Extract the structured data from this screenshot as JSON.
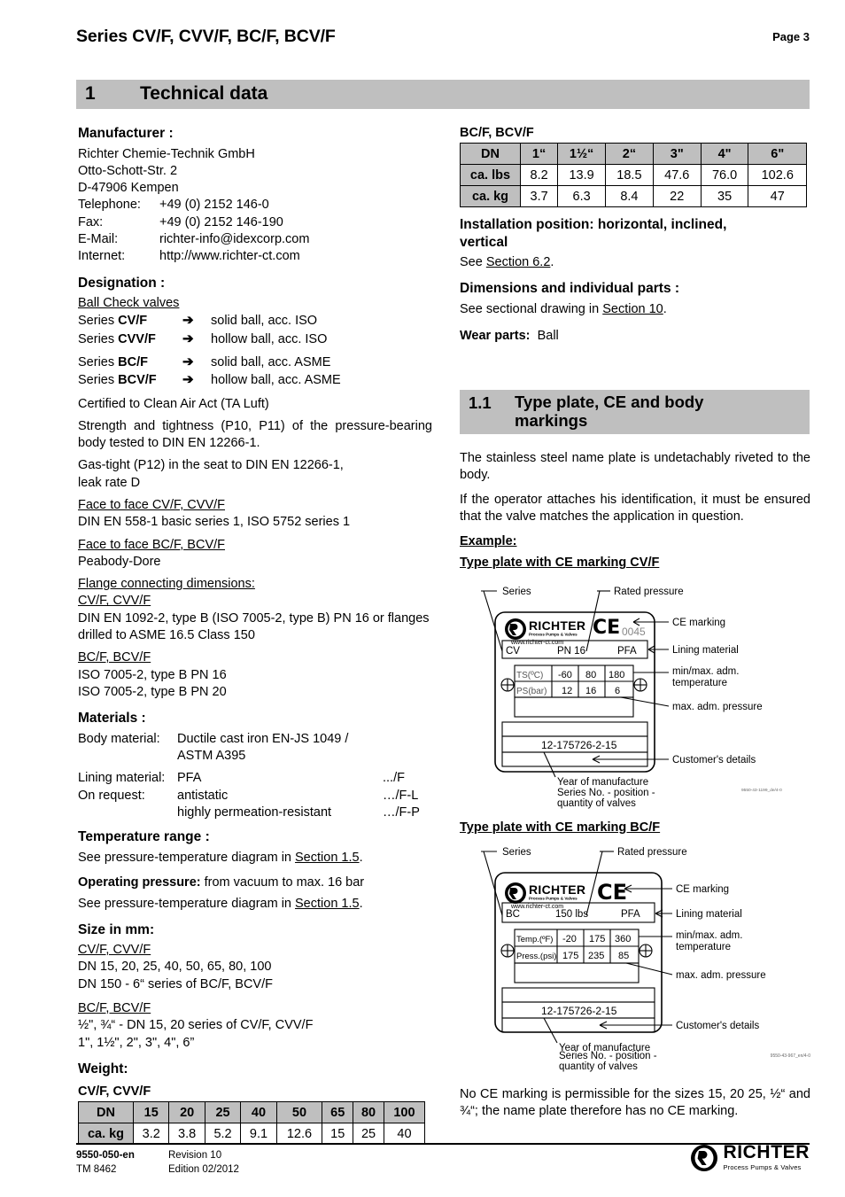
{
  "header": {
    "title": "Series CV/F, CVV/F, BC/F, BCV/F",
    "page_label": "Page 3"
  },
  "section1": {
    "number": "1",
    "title": "Technical data"
  },
  "manufacturer": {
    "heading": "Manufacturer :",
    "company": "Richter Chemie-Technik GmbH",
    "street": "Otto-Schott-Str. 2",
    "city": "D-47906 Kempen",
    "telephone_label": "Telephone:",
    "telephone": "+49 (0) 2152 146-0",
    "fax_label": "Fax:",
    "fax": "+49 (0) 2152 146-190",
    "email_label": "E-Mail:",
    "email": "richter-info@idexcorp.com",
    "internet_label": "Internet:",
    "internet": "http://www.richter-ct.com"
  },
  "designation": {
    "heading": "Designation :",
    "subtitle": "Ball Check valves",
    "rows": [
      {
        "series": "Series CV/F",
        "series_plain": "Series ",
        "series_bold": "CV/F",
        "arrow": "➔",
        "desc": "solid ball, acc. ISO"
      },
      {
        "series_plain": "Series ",
        "series_bold": "CVV/F",
        "arrow": "➔",
        "desc": "hollow ball, acc. ISO"
      },
      {
        "series_plain": "Series ",
        "series_bold": "BC/F",
        "arrow": "➔",
        "desc": "solid ball, acc. ASME"
      },
      {
        "series_plain": "Series ",
        "series_bold": "BCV/F",
        "arrow": "➔",
        "desc": "hollow ball, acc. ASME"
      }
    ],
    "certified": "Certified to Clean Air Act (TA Luft)",
    "strength": "Strength and tightness (P10, P11) of the pressure-bearing body tested to DIN EN 12266-1.",
    "gastight_1": "Gas-tight (P12) in the seat  to DIN EN 12266-1,",
    "gastight_2": "leak rate D",
    "f2f_cv_head": "Face to face CV/F, CVV/F",
    "f2f_cv_val": "DIN EN 558-1 basic series 1, ISO 5752 series 1",
    "f2f_bc_head": "Face to face BC/F, BCV/F",
    "f2f_bc_val": "Peabody-Dore",
    "flange_head": "Flange connecting dimensions:",
    "flange_cv_head": "CV/F, CVV/F",
    "flange_cv_val": "DIN EN 1092-2, type B  (ISO 7005-2, type B) PN 16 or flanges drilled to ASME 16.5 Class 150",
    "flange_bc_head": "BC/F, BCV/F",
    "flange_bc_val1": "ISO 7005-2, type B PN 16",
    "flange_bc_val2": "ISO 7005-2, type B PN 20"
  },
  "materials": {
    "heading": "Materials :",
    "body_label": "Body material:",
    "body_val1": "Ductile cast iron EN-JS 1049 /",
    "body_val2": "ASTM A395",
    "lining_label": "Lining material:",
    "lining_val": "PFA",
    "lining_code": ".../F",
    "request_label": "On request:",
    "request_val1": "antistatic",
    "request_code1": "…/F-L",
    "request_val2": "highly permeation-resistant",
    "request_code2": "…/F-P"
  },
  "temperature": {
    "heading": "Temperature range :",
    "text_pre": "See pressure-temperature diagram in ",
    "text_link": "Section 1.5",
    "text_post": "."
  },
  "operating": {
    "heading": "Operating pressure:",
    "heading_rest": " from vacuum to max. 16 bar",
    "text_pre": "See pressure-temperature diagram in ",
    "text_link": "Section 1.5",
    "text_post": "."
  },
  "size": {
    "heading": "Size in mm:",
    "cv_head": "CV/F, CVV/F",
    "cv_line1": "DN 15, 20, 25, 40, 50, 65, 80, 100",
    "cv_line2": "DN 150 - 6“ series of BC/F, BCV/F",
    "bc_head": "BC/F, BCV/F",
    "bc_line1": "½\", ¾“ - DN 15, 20 series of CV/F, CVV/F",
    "bc_line2": "1\", 1½\", 2\", 3\", 4\", 6”"
  },
  "weight": {
    "heading": "Weight:",
    "cv_subhead": "CV/F, CVV/F"
  },
  "chart_data": [
    {
      "type": "table",
      "title": "CV/F, CVV/F",
      "row_headers": [
        "DN",
        "ca. kg"
      ],
      "categories": [
        "15",
        "20",
        "25",
        "40",
        "50",
        "65",
        "80",
        "100"
      ],
      "values": [
        "3.2",
        "3.8",
        "5.2",
        "9.1",
        "12.6",
        "15",
        "25",
        "40"
      ]
    },
    {
      "type": "table",
      "title": "BC/F, BCV/F",
      "row_headers": [
        "DN",
        "ca. lbs",
        "ca. kg"
      ],
      "categories": [
        "1“",
        "1½“",
        "2“",
        "3\"",
        "4\"",
        "6\""
      ],
      "series": [
        {
          "name": "ca. lbs",
          "values": [
            "8.2",
            "13.9",
            "18.5",
            "47.6",
            "76.0",
            "102.6"
          ]
        },
        {
          "name": "ca. kg",
          "values": [
            "3.7",
            "6.3",
            "8.4",
            "22",
            "35",
            "47"
          ]
        }
      ]
    }
  ],
  "right": {
    "bc_table_head": "BC/F, BCV/F",
    "install_heading_1": "Installation position: horizontal, inclined,",
    "install_heading_2": "vertical",
    "install_see_pre": "See ",
    "install_see_link": "Section 6.2",
    "install_see_post": ".",
    "dims_heading": "Dimensions and individual parts :",
    "dims_pre": "See sectional drawing in ",
    "dims_link": "Section 10",
    "dims_post": ".",
    "wear_heading": "Wear parts:",
    "wear_value": "Ball"
  },
  "section11": {
    "number": "1.1",
    "title_line1": "Type plate, CE and body",
    "title_line2": "markings",
    "para1": "The stainless steel name plate is undetachably riveted to the body.",
    "para2": "If the operator attaches his identification, it must be ensured that the valve matches the application in question.",
    "example_label": "Example:",
    "plate_cv_caption": "Type plate with CE marking CV/F",
    "plate_bc_caption": "Type plate with CE marking BC/F",
    "closing_note": "No CE marking is permissible for the sizes 15, 20 25, ½“ and ¾“; the name plate therefore has no CE marking."
  },
  "plate_cv": {
    "callout_series": "Series",
    "callout_rated": "Rated pressure",
    "callout_ce": "CE marking",
    "callout_lining": "Lining material",
    "callout_temp_1": "min/max. adm.",
    "callout_temp_2": "temperature",
    "callout_press": "max. adm. pressure",
    "callout_customer": "Customer's details",
    "callout_year_1": "Year of manufacture",
    "callout_year_2": "Series No. - position -",
    "callout_year_3": "quantity of valves",
    "brand": "RICHTER",
    "brand_sub": "Process Pumps & Valves",
    "url": "www.richter-ct.com",
    "ce_text": "CE",
    "ce_number": "0045",
    "series_code": "CV",
    "rated_pressure": "PN 16",
    "lining": "PFA",
    "temp_row_label": "TS(ºC)",
    "press_row_label": "PS(bar)",
    "temp_values": [
      "-60",
      "80",
      "180"
    ],
    "press_values": [
      "12",
      "16",
      "6"
    ],
    "serial": "12-175726-2-15",
    "drawing_ref": "9550-43-1199_de/4-0"
  },
  "plate_bc": {
    "callout_series": "Series",
    "callout_rated": "Rated pressure",
    "callout_ce": "CE marking",
    "callout_lining": "Lining material",
    "callout_temp_1": "min/max. adm.",
    "callout_temp_2": "temperature",
    "callout_press": "max. adm. pressure",
    "callout_customer": "Customer's details",
    "callout_year_1": "Year of manufacture",
    "callout_year_2": "Series No. - position -",
    "callout_year_3": "quantity of valves",
    "brand": "RICHTER",
    "brand_sub": "Process Pumps & Valves",
    "url": "www.richter-ct.com",
    "ce_text": "CE",
    "series_code": "BC",
    "rated_pressure": "150 lbs",
    "lining": "PFA",
    "temp_row_label": "Temp.(ºF)",
    "press_row_label": "Press.(psi)",
    "temp_values": [
      "-20",
      "175",
      "360"
    ],
    "press_values": [
      "175",
      "235",
      "85"
    ],
    "serial": "12-175726-2-15",
    "drawing_ref": "9550-43-967_en/4-0"
  },
  "footer": {
    "doc_no": "9550-050-en",
    "tm_no": "TM 8462",
    "revision": "Revision  10",
    "edition": "Edition  02/2012",
    "logo_text": "RICHTER",
    "logo_sub": "Process Pumps & Valves"
  }
}
